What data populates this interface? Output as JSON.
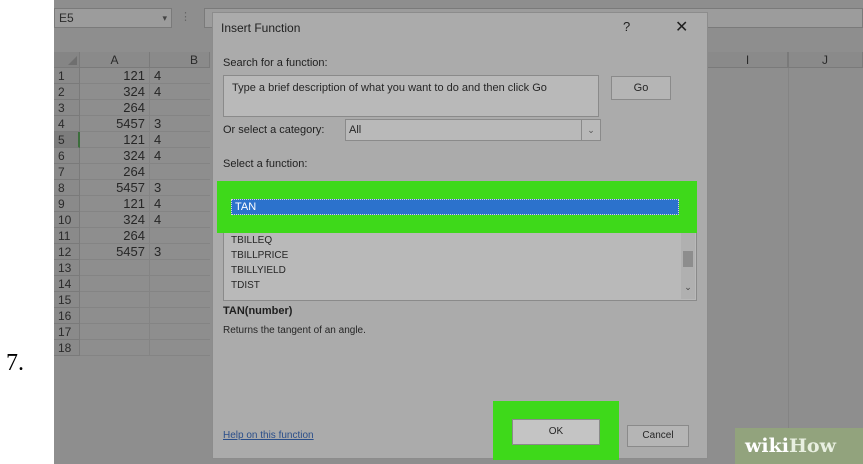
{
  "step_number": "7.",
  "excel": {
    "name_box": "E5",
    "column_headers": [
      "A",
      "B",
      "I",
      "J"
    ],
    "row_numbers": [
      "1",
      "2",
      "3",
      "4",
      "5",
      "6",
      "7",
      "8",
      "9",
      "10",
      "11",
      "12",
      "13",
      "14",
      "15",
      "16",
      "17",
      "18"
    ],
    "selected_row": "5",
    "column_a": [
      "121",
      "324",
      "264",
      "5457",
      "121",
      "324",
      "264",
      "5457",
      "121",
      "324",
      "264",
      "5457"
    ],
    "column_b_partial": [
      "4",
      "4",
      "",
      "3",
      "4",
      "4",
      "",
      "3",
      "4",
      "4",
      "",
      "3"
    ]
  },
  "dialog": {
    "title": "Insert Function",
    "help_glyph": "?",
    "close_glyph": "✕",
    "search_label": "Search for a function:",
    "search_value": "Type a brief description of what you want to do and then click Go",
    "go_label": "Go",
    "category_label": "Or select a category:",
    "category_value": "All",
    "select_label": "Select a function:",
    "functions": [
      "TAN",
      "TBILLEQ",
      "TBILLPRICE",
      "TBILLYIELD",
      "TDIST"
    ],
    "selected_function": "TAN",
    "signature": "TAN(number)",
    "description": "Returns the tangent of an angle.",
    "help_link": "Help on this function",
    "ok_label": "OK",
    "cancel_label": "Cancel"
  },
  "highlight_color": "#3ed91a",
  "watermark": {
    "part1": "wiki",
    "part2": "How"
  }
}
